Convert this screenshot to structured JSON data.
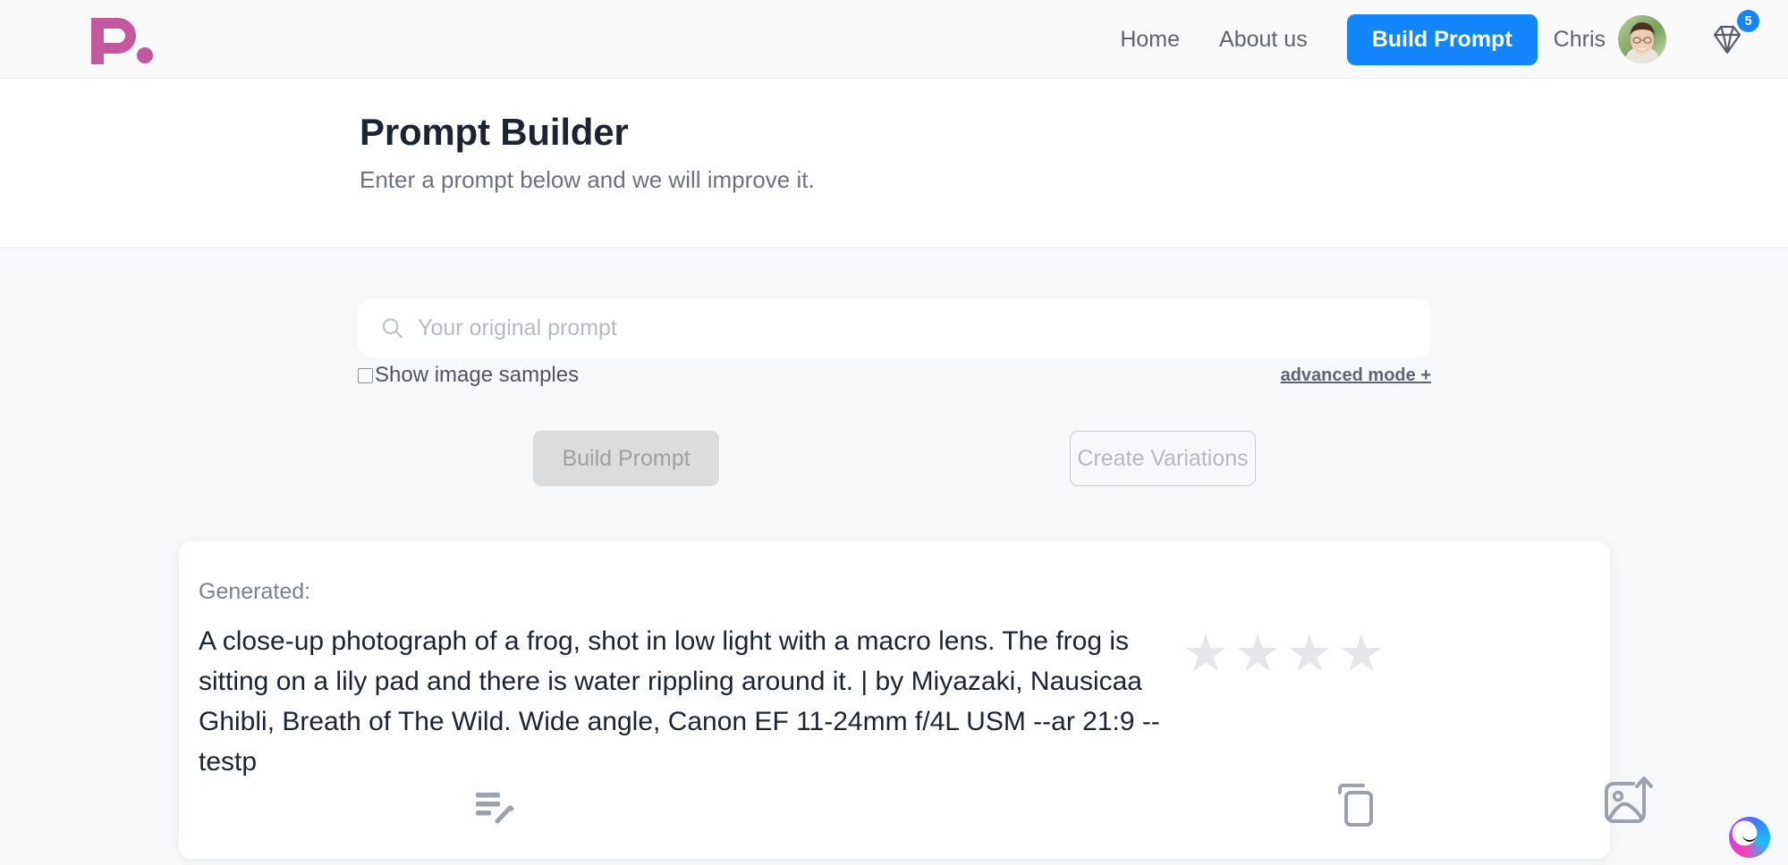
{
  "brand": {
    "logo_text": "P.",
    "logo_color": "#c4589f",
    "accent_blue": "#1386fb"
  },
  "header": {
    "nav_links": [
      {
        "label": "Home",
        "name": "nav-home"
      },
      {
        "label": "About us",
        "name": "nav-about-us"
      }
    ],
    "build_prompt_label": "Build Prompt",
    "user_name": "Chris",
    "gem_badge_count": "5"
  },
  "hero": {
    "title": "Prompt Builder",
    "subtitle": "Enter a prompt below and we will improve it."
  },
  "search": {
    "placeholder": "Your original prompt",
    "value": "",
    "checkbox_label": "Show image samples",
    "checkbox_checked": false,
    "advanced_mode_label": "advanced mode +"
  },
  "actions": {
    "build_prompt_label": "Build Prompt",
    "create_variations_label": "Create Variations"
  },
  "result_card": {
    "generated_label": "Generated:",
    "generated_text": "A close-up photograph of a frog, shot in low light with a macro lens. The frog is sitting on a lily pad and there is water rippling around it. | by Miyazaki, Nausicaa Ghibli, Breath of The Wild. Wide angle, Canon EF 11-24mm f/4L USM --ar 21:9 --testp",
    "rating": {
      "stars_shown": 4,
      "stars_filled": 0,
      "star_glyph": "★",
      "empty_color": "#e4e6e9"
    },
    "icons": [
      {
        "name": "edit-text-icon",
        "label": "Edit prompt"
      },
      {
        "name": "copy-icon",
        "label": "Copy prompt"
      },
      {
        "name": "image-upload-icon",
        "label": "Upload image"
      }
    ]
  }
}
